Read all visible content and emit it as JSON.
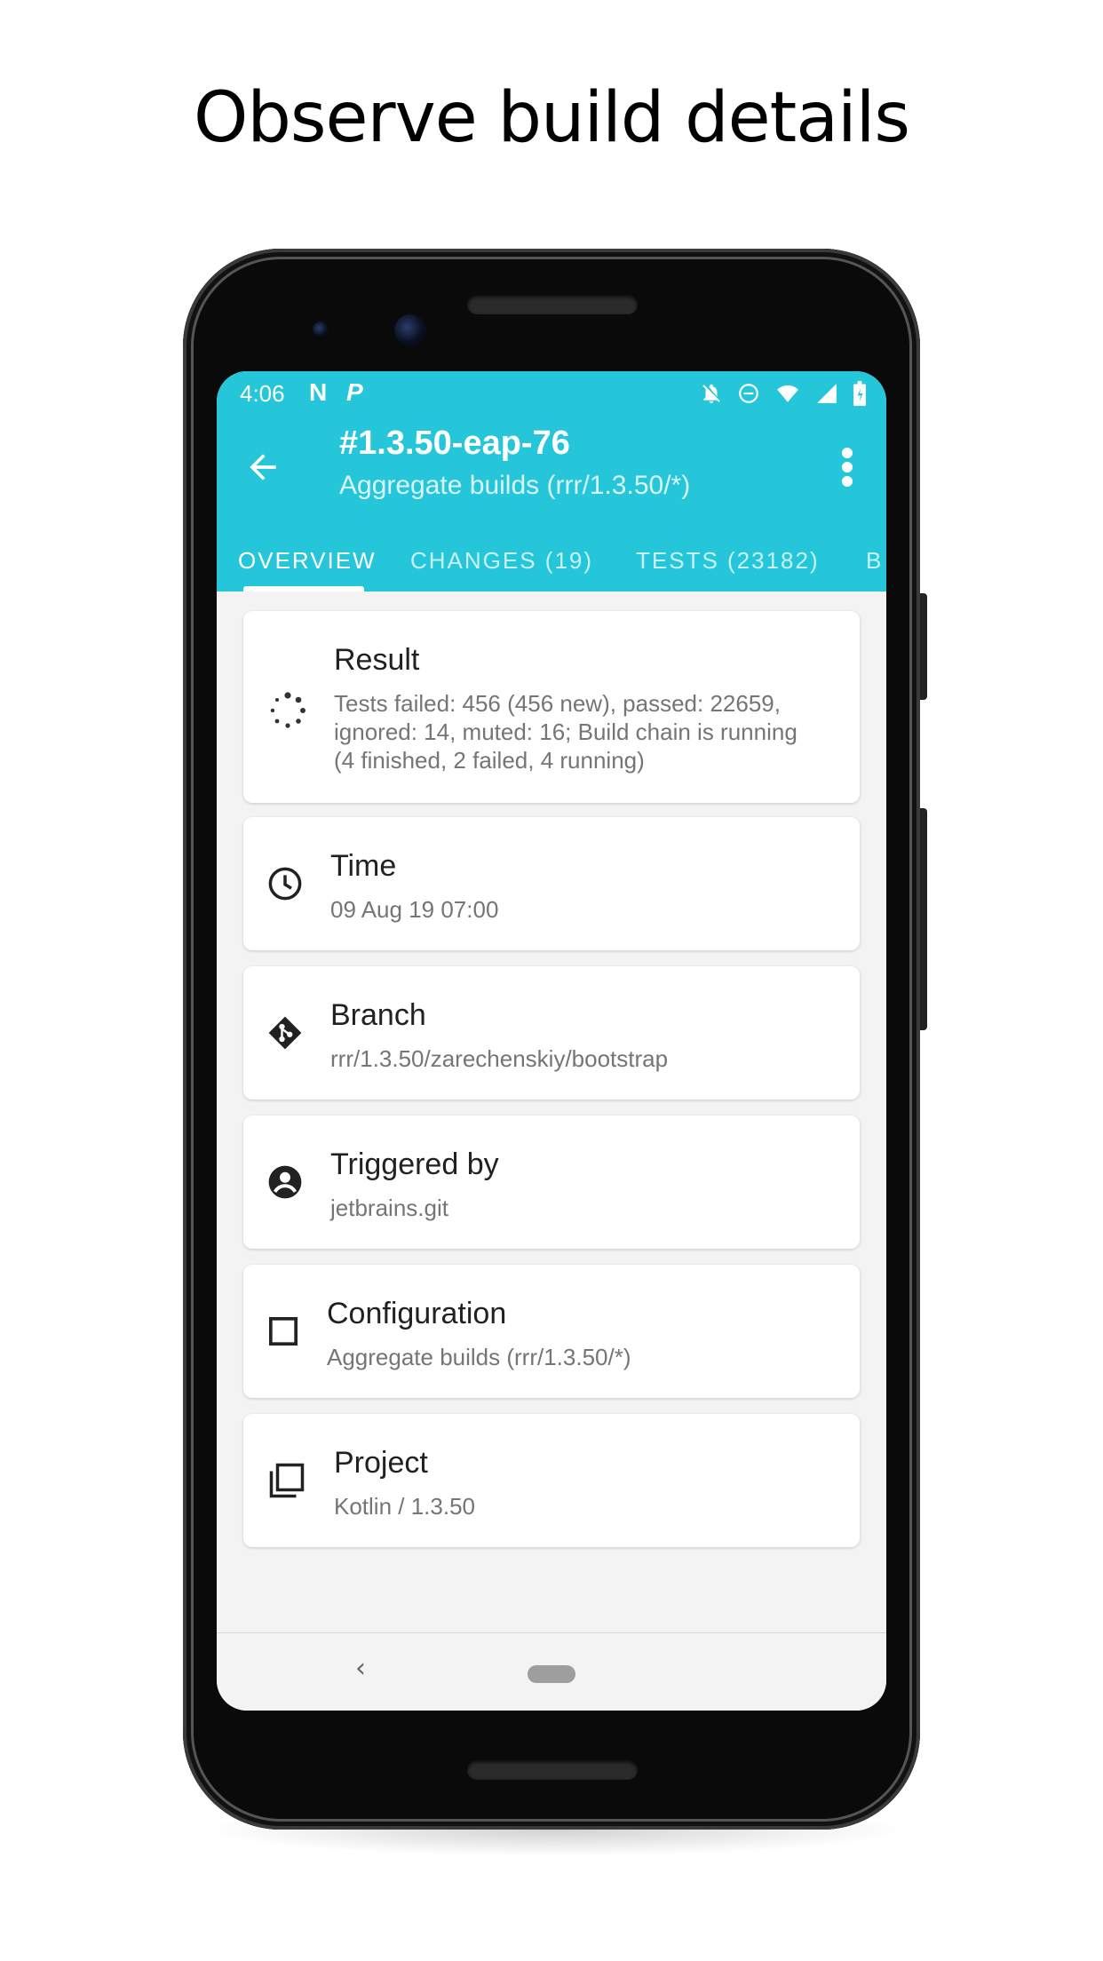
{
  "headline": "Observe build details",
  "status_bar": {
    "time": "4:06",
    "left_icons": [
      "N",
      "P"
    ],
    "right_icons": [
      "notifications-off-icon",
      "do-not-disturb-icon",
      "wifi-icon",
      "cellular-signal-icon",
      "battery-icon"
    ]
  },
  "app_bar": {
    "title": "#1.3.50-eap-76",
    "subtitle": "Aggregate builds (rrr/1.3.50/*)",
    "background": "#26c6da"
  },
  "tabs": [
    {
      "label": "OVERVIEW",
      "active": true
    },
    {
      "label": "CHANGES (19)",
      "active": false
    },
    {
      "label": "TESTS (23182)",
      "active": false
    },
    {
      "label": "B",
      "active": false
    }
  ],
  "cards": [
    {
      "icon": "loading-spinner-icon",
      "title": "Result",
      "value_lines": [
        "Tests failed: 456 (456 new), passed: 22659,",
        "ignored: 14, muted: 16; Build chain is running",
        "(4 finished, 2 failed, 4 running)"
      ]
    },
    {
      "icon": "clock-icon",
      "title": "Time",
      "value": "09 Aug 19 07:00"
    },
    {
      "icon": "git-branch-icon",
      "title": "Branch",
      "value": "rrr/1.3.50/zarechenskiy/bootstrap"
    },
    {
      "icon": "account-circle-icon",
      "title": "Triggered by",
      "value": "jetbrains.git"
    },
    {
      "icon": "checkbox-outline-icon",
      "title": "Configuration",
      "value": "Aggregate builds (rrr/1.3.50/*)"
    },
    {
      "icon": "library-icon",
      "title": "Project",
      "value": "Kotlin / 1.3.50"
    }
  ],
  "nav_bar": {
    "back_glyph": "‹"
  }
}
